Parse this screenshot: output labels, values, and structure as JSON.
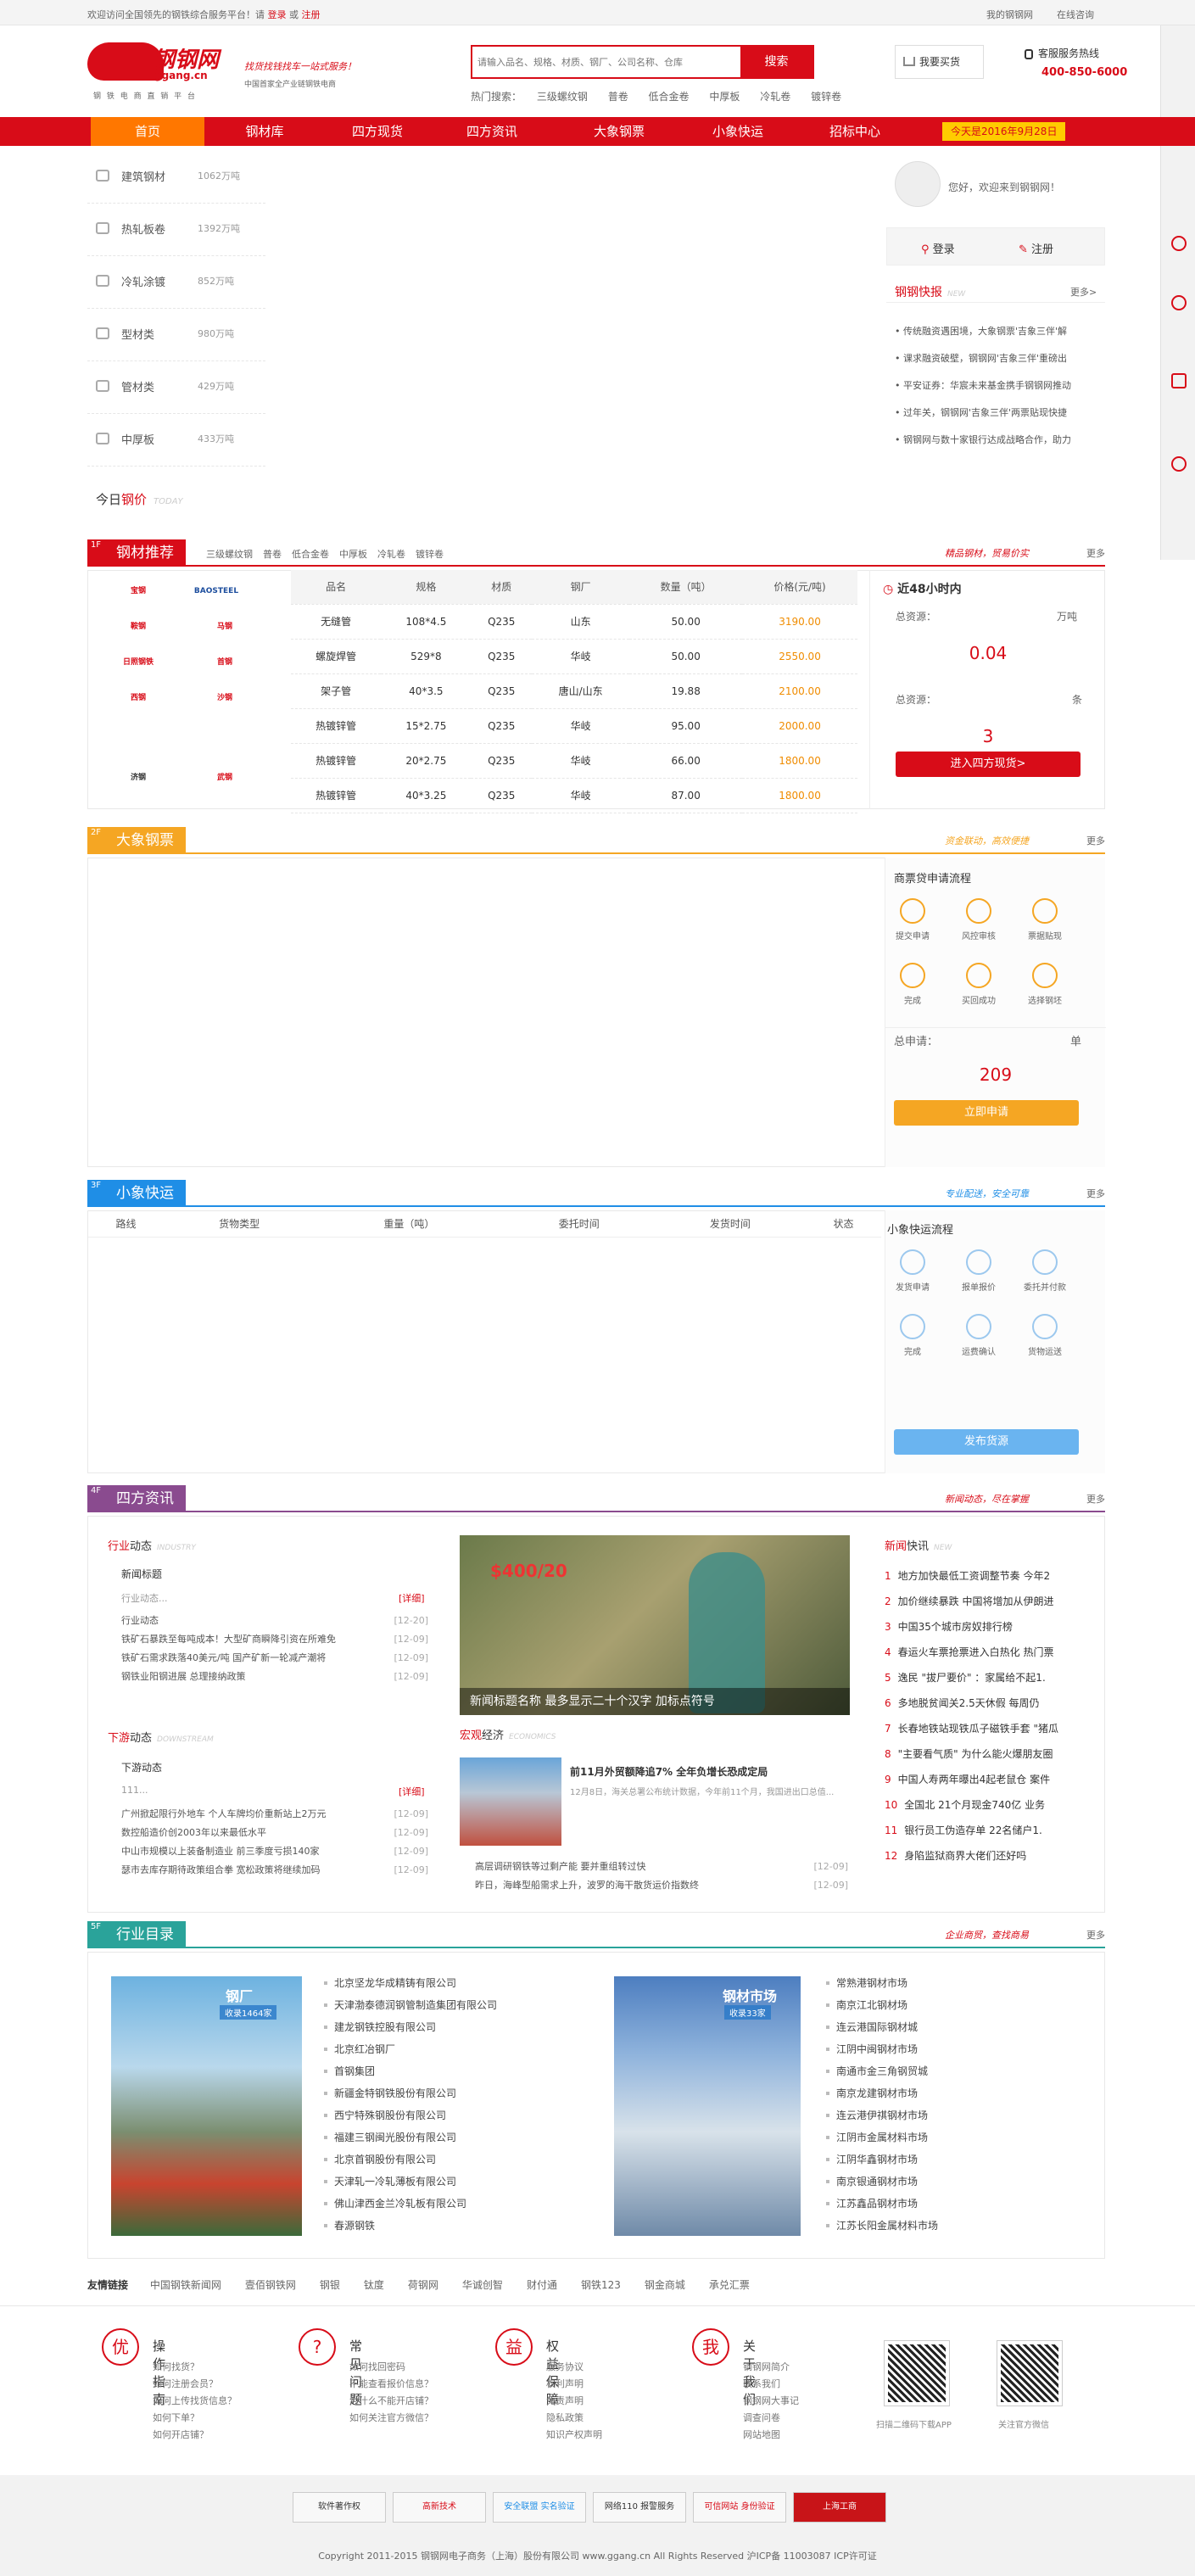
{
  "topbar": {
    "welcome": "欢迎访问全国领先的钢铁综合服务平台！请",
    "login": "登录",
    "or": "或",
    "register": "注册",
    "my_account": "我的钢钢网",
    "contact": "在线咨询"
  },
  "header": {
    "logo": "钢钢网",
    "logo_sub": "ggang.cn",
    "logo_motto": "钢 铁 电 商 直 销 平 台",
    "slogan_1": "找货找钱找车一站式服务！",
    "slogan_2": "中国首家全产业链钢铁电商",
    "search_placeholder": "请输入品名、规格、材质、钢厂、公司名称、仓库",
    "search_button": "搜索",
    "cart": "我要买货",
    "hot_label": "热门搜索：",
    "hot": [
      "三级螺纹钢",
      "普卷",
      "低合金卷",
      "中厚板",
      "冷轧卷",
      "镀锌卷"
    ],
    "hotline_label": "客服服务热线",
    "hotline": "400-850-6000"
  },
  "nav": {
    "items": [
      "首页",
      "钢材库",
      "四方现货",
      "四方资讯",
      "大象钢票",
      "小象快运",
      "招标中心"
    ],
    "date": "今天是2016年9月28日"
  },
  "categories": [
    {
      "name": "建筑钢材",
      "value": "1062万吨"
    },
    {
      "name": "热轧板卷",
      "value": "1392万吨"
    },
    {
      "name": "冷轧涂镀",
      "value": "852万吨"
    },
    {
      "name": "型材类",
      "value": "980万吨"
    },
    {
      "name": "管材类",
      "value": "429万吨"
    },
    {
      "name": "中厚板",
      "value": "433万吨"
    }
  ],
  "today_price": {
    "prefix": "今日",
    "emph": "钢价",
    "en": "TODAY"
  },
  "user": {
    "greeting": "您好，欢迎来到钢钢网！",
    "login": "登录",
    "register": "注册"
  },
  "express": {
    "title": "钢钢快报",
    "en": "NEW",
    "more": "更多>",
    "items": [
      "传统融资遇困境，大象钢票'吉象三伴'解",
      "课求融资破壁，钢钢网'吉象三伴'重磅出",
      "平安证券：华宸未来基金携手钢钢网推动",
      "过年关，钢钢网'吉象三伴'两票贴现快捷",
      "钢钢网与数十家银行达成战略合作，助力"
    ]
  },
  "f1": {
    "num": "1F",
    "tag": "钢材推荐",
    "subs": [
      "三级螺纹钢",
      "普卷",
      "低合金卷",
      "中厚板",
      "冷轧卷",
      "镀锌卷"
    ],
    "slogan": "精品钢材，贸易价实",
    "more": "更多",
    "logos": [
      "宝钢",
      "BAOSTEEL",
      "鞍钢",
      "马钢",
      "日照钢铁",
      "首钢",
      "西钢",
      "沙钢",
      "济钢",
      "武钢"
    ],
    "headers": [
      "品名",
      "规格",
      "材质",
      "钢厂",
      "数量（吨）",
      "价格(元/吨)"
    ],
    "rows": [
      [
        "无缝管",
        "108*4.5",
        "Q235",
        "山东",
        "50.00",
        "3190.00"
      ],
      [
        "螺旋焊管",
        "529*8",
        "Q235",
        "华岐",
        "50.00",
        "2550.00"
      ],
      [
        "架子管",
        "40*3.5",
        "Q235",
        "唐山/山东",
        "19.88",
        "2100.00"
      ],
      [
        "热镀锌管",
        "15*2.75",
        "Q235",
        "华岐",
        "95.00",
        "2000.00"
      ],
      [
        "热镀锌管",
        "20*2.75",
        "Q235",
        "华岐",
        "66.00",
        "1800.00"
      ],
      [
        "热镀锌管",
        "40*3.25",
        "Q235",
        "华岐",
        "87.00",
        "1800.00"
      ]
    ],
    "stat_title": "近48小时内",
    "total_label": "总资源：",
    "unit1": "万吨",
    "total_value": "0.04",
    "total2_label": "总资源：",
    "unit2": "条",
    "total2_value": "3",
    "button": "进入四方现货>"
  },
  "f2": {
    "num": "2F",
    "tag": "大象钢票",
    "slogan": "资金联动，高效便捷",
    "more": "更多",
    "flow_title": "商票贷申请流程",
    "steps": [
      "提交申请",
      "风控审核",
      "票据贴现",
      "完成",
      "买回成功",
      "选择钢坯"
    ],
    "apply_label": "总申请：",
    "unit": "单",
    "apply_value": "209",
    "button": "立即申请"
  },
  "f3": {
    "num": "3F",
    "tag": "小象快运",
    "slogan": "专业配送，安全可靠",
    "more": "更多",
    "headers": [
      "路线",
      "货物类型",
      "重量（吨）",
      "委托时间",
      "发货时间",
      "状态"
    ],
    "flow_title": "小象快运流程",
    "steps": [
      "发货申请",
      "报单报价",
      "委托并付款",
      "完成",
      "运费确认",
      "货物运送"
    ],
    "button": "发布货源"
  },
  "f4": {
    "num": "4F",
    "tag": "四方资讯",
    "slogan": "新闻动态，尽在掌握",
    "more": "更多",
    "industry_title": "行业",
    "industry_emph": "动态",
    "industry_en": "INDUSTRY",
    "ind_head": "新闻标题",
    "ind_sub": "行业动态...",
    "detail": "[详细]",
    "ind_list": [
      {
        "t": "行业动态",
        "d": "[12-20]"
      },
      {
        "t": "铁矿石暴跌至每吨成本！大型矿商瞬降引资在所难免",
        "d": "[12-09]"
      },
      {
        "t": "铁矿石需求跌落40美元/吨 国产矿新一轮减产潮将",
        "d": "[12-09]"
      },
      {
        "t": "钢铁业阳钢进展 总理接纳政策",
        "d": "[12-09]"
      }
    ],
    "down_title": "下游",
    "down_emph": "动态",
    "down_en": "DOWNSTREAM",
    "down_head": "下游动态",
    "down_sub": "111...",
    "down_list": [
      {
        "t": "广州掀起限行外地车 个人车牌均价重新站上2万元",
        "d": "[12-09]"
      },
      {
        "t": "数控船造价创2003年以来最低水平",
        "d": "[12-09]"
      },
      {
        "t": "中山市规模以上装备制造业 前三季度亏损140家",
        "d": "[12-09]"
      },
      {
        "t": "瑟市去库存期待政策组合拳 宽松政策将继续加码",
        "d": "[12-09]"
      }
    ],
    "banner_caption": "新闻标题名称 最多显示二十个汉字 加标点符号",
    "banner_price": "$400/20",
    "macro_title": "宏观",
    "macro_emph": "经济",
    "macro_en": "ECONOMICS",
    "macro_head": "前11月外贸额降追7% 全年负增长恐成定局",
    "macro_desc": "12月8日，海关总署公布统计数据，今年前11个月，我国进出口总值...",
    "macro_list": [
      {
        "t": "高层调研钢铁等过剩产能 要并重组转过快",
        "d": "[12-09]"
      },
      {
        "t": "昨日，海峰型船需求上升，波罗的海干散货运价指数终",
        "d": "[12-09]"
      }
    ],
    "news_title": "新闻",
    "news_emph": "快讯",
    "news_en": "NEW",
    "news": [
      "地方加快最低工资调整节奏 今年2",
      "加价继续暴跌 中国将增加从伊朗进",
      "中国35个城市房奴排行榜",
      "春运火车票抢票进入白热化 热门票",
      "逸民 \"拔尸要价\" ：家属给不起1.",
      "多地脱贫闻关2.5天休假 每周仍",
      "长春地铁站现铁瓜子磁铁手套 \"猪瓜",
      "\"主要看气质\" 为什么能火爆朋友圈",
      "中国人寿两年曝出4起老鼠仓 案件",
      "全国北 21个月现金740亿 业务",
      "银行员工伪造存单 22名储户1.",
      "身陷监狱商界大佬们还好吗"
    ]
  },
  "f5": {
    "num": "5F",
    "tag": "行业目录",
    "slogan": "企业商贸，查找商易",
    "more": "更多",
    "mill_label": "钢厂",
    "mill_count": "收录1464家",
    "market_label": "钢材市场",
    "market_count": "收录33家",
    "mills": [
      "北京坚龙华成精铸有限公司",
      "天津渤泰德润钢管制造集团有限公司",
      "建龙钢铁控股有限公司",
      "北京红冶钢厂",
      "首钢集团",
      "新疆金特钢铁股份有限公司",
      "西宁特殊钢股份有限公司",
      "福建三钢闽光股份有限公司",
      "北京首钢股份有限公司",
      "天津轧一冷轧薄板有限公司",
      "佛山津西金兰冷轧板有限公司",
      "春源钢铁"
    ],
    "markets": [
      "常熟港钢材市场",
      "南京江北钢材场",
      "连云港国际钢材城",
      "江阴中闽钢材市场",
      "南通市金三角钢贸城",
      "南京龙建钢材市场",
      "连云港伊祺钢材市场",
      "江阴市金属材料市场",
      "江阴华鑫钢材市场",
      "南京银通钢材市场",
      "江苏鑫品钢材市场",
      "江苏长阳金属材料市场"
    ]
  },
  "links": {
    "label": "友情链接",
    "items": [
      "中国钢铁新闻网",
      "壹佰钢铁网",
      "钢银",
      "钛度",
      "荷钢网",
      "华诚创智",
      "财付通",
      "钢铁123",
      "钢金商城",
      "承兑汇票"
    ]
  },
  "footer": {
    "cols": [
      {
        "icon": "优",
        "title": "操作指南",
        "items": [
          "如何找货？",
          "如何注册会员？",
          "如何上传找货信息？",
          "如何下单？",
          "如何开店铺？"
        ]
      },
      {
        "icon": "?",
        "title": "常见问题",
        "items": [
          "如何找回密码",
          "不能查看报价信息？",
          "为什么不能开店铺？",
          "如何关注官方微信？"
        ]
      },
      {
        "icon": "益",
        "title": "权益保障",
        "items": [
          "服务协议",
          "权利声明",
          "免责声明",
          "隐私政策",
          "知识产权声明"
        ]
      },
      {
        "icon": "我",
        "title": "关于我们",
        "items": [
          "钢钢网简介",
          "联系我们",
          "钢钢网大事记",
          "调查问卷",
          "网站地图"
        ]
      }
    ],
    "qr1": "扫描二维码下载APP",
    "qr2": "关注官方微信",
    "badges": [
      "软件著作权",
      "高新技术",
      "安全联盟 实名验证",
      "网络110 报警服务",
      "可信网站 身份验证",
      "上海工商"
    ],
    "copyright": "Copyright 2011-2015 钢钢网电子商务（上海）股份有限公司 www.ggang.cn All Rights Reserved 沪ICP备 11003087 ICP许可证"
  },
  "colors": {
    "red": "#d80c18",
    "orange": "#f5a623",
    "blue": "#1f8ee6",
    "purple": "#8a4b8f",
    "teal": "#2aa39a"
  }
}
